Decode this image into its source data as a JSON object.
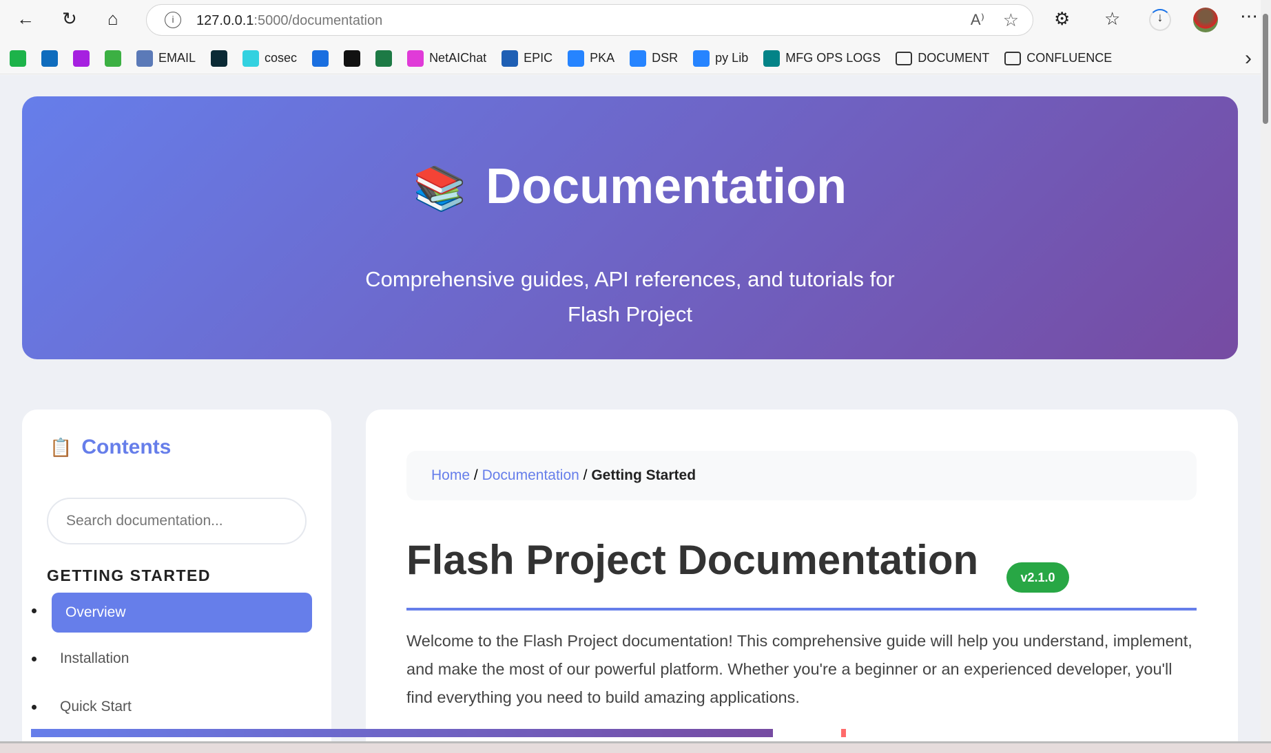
{
  "browser": {
    "url_host": "127.0.0.1",
    "url_rest": ":5000/documentation",
    "bookmarks": [
      {
        "label": "",
        "color": "#1db34a"
      },
      {
        "label": "",
        "color": "#0f6cbd"
      },
      {
        "label": "",
        "color": "#a620e0"
      },
      {
        "label": "",
        "color": "#3cb043"
      },
      {
        "label": "EMAIL",
        "color": "#5b7ab8"
      },
      {
        "label": "",
        "color": "#0b2a35"
      },
      {
        "label": "cosec",
        "color": "#33d1e0"
      },
      {
        "label": "",
        "color": "#1a6fe0"
      },
      {
        "label": "",
        "color": "#111111"
      },
      {
        "label": "",
        "color": "#1d7a45"
      },
      {
        "label": "NetAIChat",
        "color": "#e03bd8"
      },
      {
        "label": "EPIC",
        "color": "#1e5fb4"
      },
      {
        "label": "PKA",
        "color": "#2684ff"
      },
      {
        "label": "DSR",
        "color": "#2684ff"
      },
      {
        "label": "py Lib",
        "color": "#2684ff"
      },
      {
        "label": "MFG OPS LOGS",
        "color": "#038387"
      },
      {
        "label": "DOCUMENT",
        "color": "folder"
      },
      {
        "label": "CONFLUENCE",
        "color": "folder"
      }
    ]
  },
  "hero": {
    "icon": "📚",
    "title": "Documentation",
    "subtitle": "Comprehensive guides, API references, and tutorials for Flash Project"
  },
  "sidebar": {
    "icon": "📋",
    "title": "Contents",
    "search_placeholder": "Search documentation...",
    "section": "GETTING STARTED",
    "items": [
      {
        "label": "Overview",
        "active": true
      },
      {
        "label": "Installation"
      },
      {
        "label": "Quick Start"
      }
    ]
  },
  "main": {
    "breadcrumb": {
      "home": "Home",
      "sep": "/",
      "docs": "Documentation",
      "current": "Getting Started"
    },
    "title": "Flash Project Documentation",
    "version": "v2.1.0",
    "intro": "Welcome to the Flash Project documentation! This comprehensive guide will help you understand, implement, and make the most of our powerful platform. Whether you're a beginner or an experienced developer, you'll find everything you need to build amazing applications."
  },
  "colors": {
    "accent": "#667eea",
    "accent2": "#764ba2",
    "badge": "#28a745"
  },
  "reading_progress_percent": 61
}
